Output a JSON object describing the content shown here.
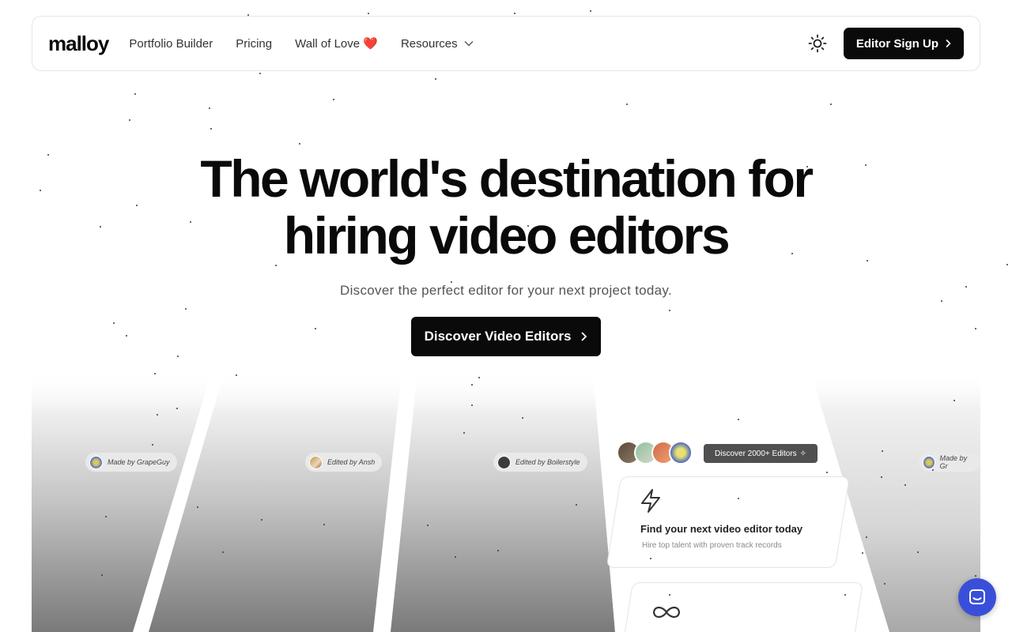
{
  "brand": {
    "logo": "malloy"
  },
  "nav": {
    "links": [
      "Portfolio Builder",
      "Pricing",
      "Wall of Love ❤️",
      "Resources"
    ],
    "theme_icon": "sun-icon",
    "signup_label": "Editor Sign Up"
  },
  "hero": {
    "title_line1": "The world's destination for",
    "title_line2": "hiring video editors",
    "subtitle": "Discover the perfect editor for your next project today.",
    "cta_label": "Discover Video Editors"
  },
  "showcase": {
    "chips": [
      "Made by GrapeGuy",
      "Edited by Ansh",
      "Edited by Boilerstyle",
      "Made by Gr"
    ],
    "badge": "Discover 2000+ Editors",
    "card1": {
      "title": "Find your next video editor today",
      "desc": "Hire top talent with proven track records",
      "icon": "lightning-icon"
    },
    "card2": {
      "icon": "infinity-icon"
    }
  },
  "chat": {
    "icon": "chat-icon"
  },
  "colors": {
    "primary": "#0a0a0a",
    "chat_accent": "#3a4fd9",
    "panel_gray": "#8a8a8a"
  }
}
